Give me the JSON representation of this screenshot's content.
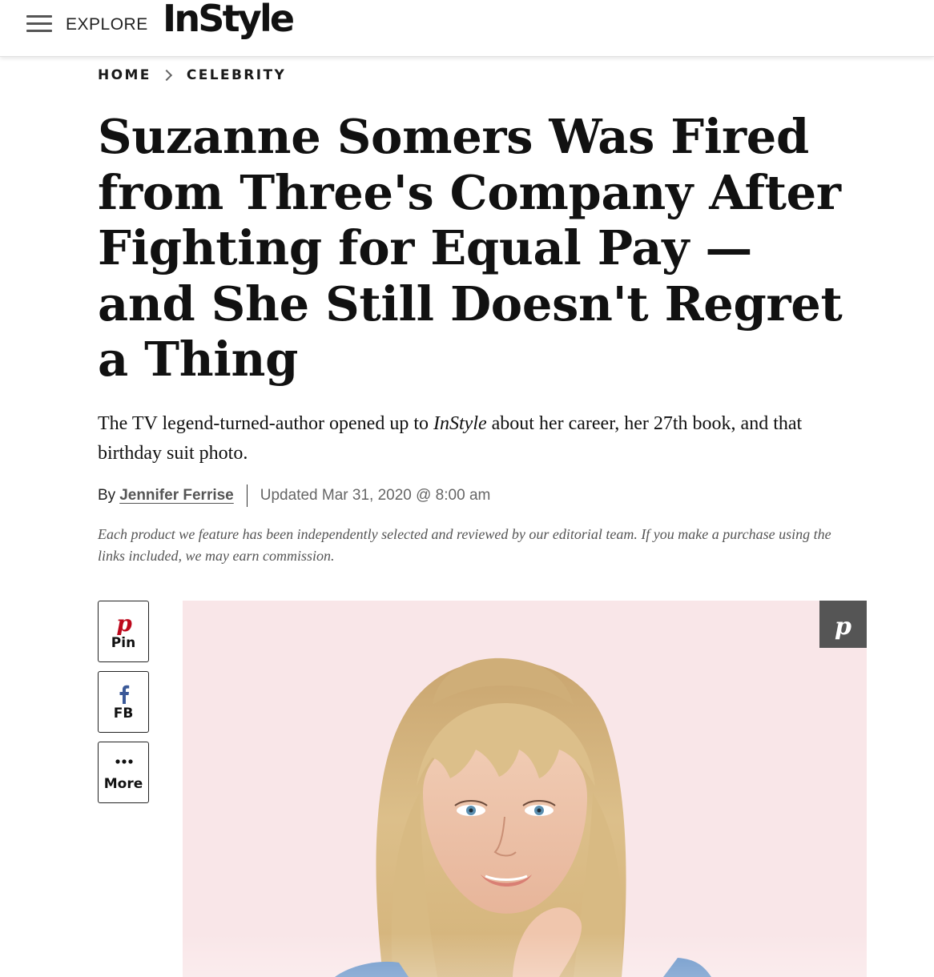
{
  "header": {
    "menu_icon": "hamburger-menu-icon",
    "explore_label": "EXPLORE",
    "logo_text": "InStyle"
  },
  "breadcrumb": {
    "items": [
      "HOME",
      "CELEBRITY"
    ],
    "separator_icon": "chevron-right-icon"
  },
  "article": {
    "headline": "Suzanne Somers Was Fired from Three's Company After Fighting for Equal Pay — and She Still Doesn't Regret a Thing",
    "dek_before": "The TV legend-turned-author opened up to ",
    "dek_italic": "InStyle",
    "dek_after": " about her career, her 27th book, and that birthday suit photo.",
    "byline_prefix": "By",
    "author": "Jennifer Ferrise",
    "updated": "Updated Mar 31, 2020 @ 8:00 am",
    "disclaimer": "Each product we feature has been independently selected and reviewed by our editorial team. If you make a purchase using the links included, we may earn commission."
  },
  "share": {
    "pin_label": "Pin",
    "fb_label": "FB",
    "more_label": "More",
    "pin_icon": "pinterest-icon",
    "fb_icon": "facebook-icon",
    "more_icon": "ellipsis-icon"
  },
  "hero_image": {
    "description_icon": "portrait-photo",
    "pin_button_icon": "pinterest-icon"
  },
  "colors": {
    "pinterest_red": "#bd081c",
    "facebook_blue": "#3b5998",
    "hero_background": "#f9e6e8",
    "pin_overlay": "#555555"
  }
}
